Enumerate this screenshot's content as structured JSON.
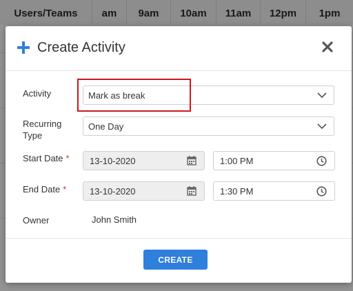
{
  "scheduler": {
    "columns": [
      "Users/Teams",
      "am",
      "9am",
      "10am",
      "11am",
      "12pm",
      "1pm"
    ]
  },
  "modal": {
    "title": "Create Activity",
    "icons": {
      "title_icon": "plus-icon",
      "close": "close-icon"
    },
    "fields": {
      "activity": {
        "label": "Activity",
        "value": "Mark as break"
      },
      "recurring_type": {
        "label": "Recurring\nType",
        "value": "One Day"
      },
      "start_date": {
        "label": "Start Date",
        "required_mark": "*",
        "date": "13-10-2020",
        "time": "1:00 PM"
      },
      "end_date": {
        "label": "End Date",
        "required_mark": "*",
        "date": "13-10-2020",
        "time": "1:30 PM"
      },
      "owner": {
        "label": "Owner",
        "value": "John Smith"
      }
    },
    "create_button": "CREATE"
  },
  "colors": {
    "accent": "#2f7fdc",
    "required": "#d9342b",
    "highlight": "#d0161b"
  }
}
